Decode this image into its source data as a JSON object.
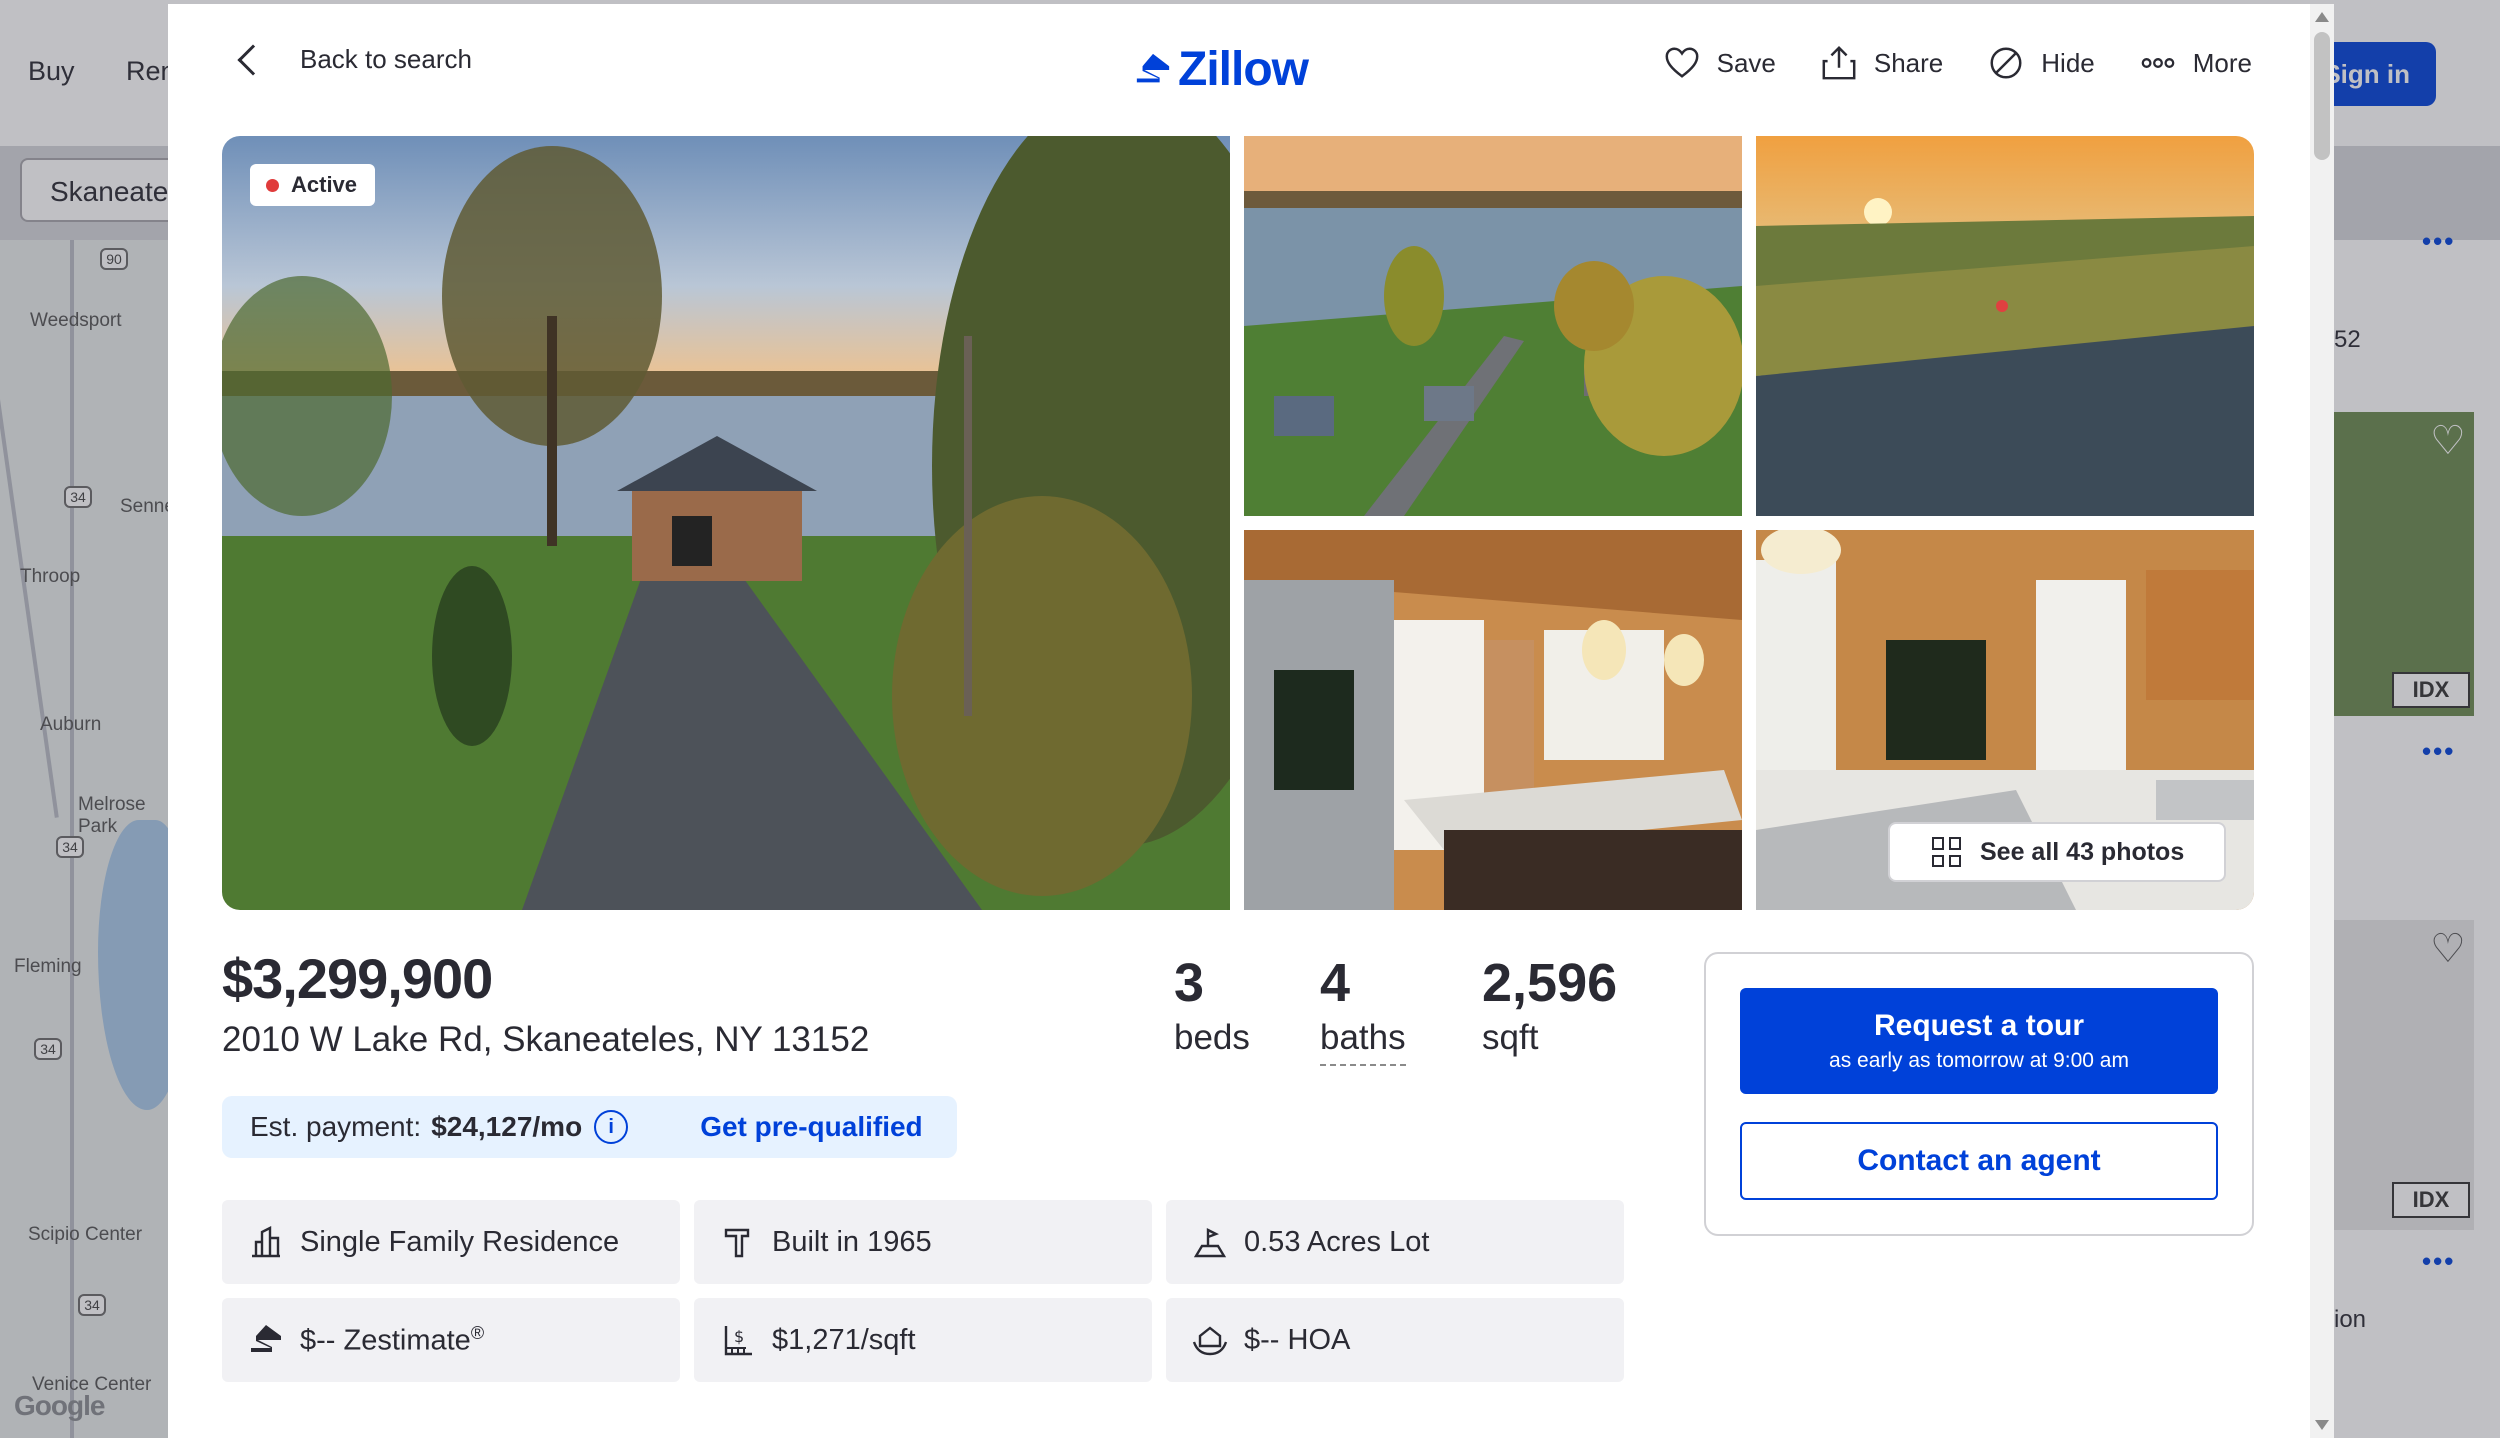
{
  "background": {
    "nav": [
      "Buy",
      "Rent"
    ],
    "sign_in": "Sign in",
    "search_value": "Skaneateles",
    "map": {
      "towns": [
        "Weedsport",
        "Throop",
        "Auburn",
        "Melrose Park",
        "Fleming",
        "Scipio Center",
        "Venice Center",
        "Sennett"
      ],
      "routes": [
        "90",
        "34",
        "34",
        "34",
        "34"
      ],
      "attribution": "Google"
    },
    "right_list": {
      "text_1": "52",
      "text_2": "ion",
      "idx_label": "IDX"
    }
  },
  "modal": {
    "back_label": "Back to search",
    "logo_text": "Zillow",
    "actions": {
      "save": "Save",
      "share": "Share",
      "hide": "Hide",
      "more": "More"
    },
    "status_badge": "Active",
    "see_all_photos": "See all 43 photos",
    "price": "$3,299,900",
    "address": "2010 W Lake Rd, Skaneateles, NY 13152",
    "stats": {
      "beds_num": "3",
      "beds_label": "beds",
      "baths_num": "4",
      "baths_label": "baths",
      "sqft_num": "2,596",
      "sqft_label": "sqft"
    },
    "payment": {
      "label": "Est. payment:",
      "value": "$24,127/mo",
      "prequal": "Get pre-qualified"
    },
    "facts": {
      "type": "Single Family Residence",
      "built": "Built in 1965",
      "lot": "0.53 Acres Lot",
      "zestimate": "$-- Zestimate",
      "zestimate_mark": "®",
      "price_sqft": "$1,271/sqft",
      "hoa": "$-- HOA"
    },
    "contact": {
      "tour_title": "Request a tour",
      "tour_sub": "as early as tomorrow at 9:00 am",
      "agent": "Contact an agent"
    },
    "colors": {
      "brand": "#0041d9",
      "active_dot": "#e03b3b",
      "payment_bg": "#e6f2ff"
    }
  }
}
